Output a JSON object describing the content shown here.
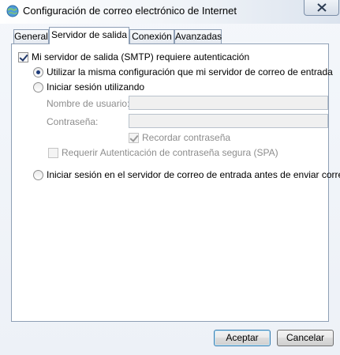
{
  "window": {
    "title": "Configuración de correo electrónico de Internet"
  },
  "tabs": [
    {
      "label": "General",
      "active": false
    },
    {
      "label": "Servidor de salida",
      "active": true
    },
    {
      "label": "Conexión",
      "active": false
    },
    {
      "label": "Avanzadas",
      "active": false
    }
  ],
  "outgoing": {
    "requires_auth": {
      "label": "Mi servidor de salida (SMTP) requiere autenticación",
      "checked": true
    },
    "option_same": {
      "label": "Utilizar la misma configuración que mi servidor de correo de entrada",
      "selected": true
    },
    "option_login": {
      "label": "Iniciar sesión utilizando",
      "selected": false
    },
    "username": {
      "label": "Nombre de usuario:",
      "value": ""
    },
    "password": {
      "label": "Contraseña:",
      "value": ""
    },
    "remember_password": {
      "label": "Recordar contraseña",
      "checked": true
    },
    "spa": {
      "label": "Requerir Autenticación de contraseña segura (SPA)",
      "checked": false
    },
    "option_before": {
      "label": "Iniciar sesión en el servidor de correo de entrada antes de enviar correo",
      "selected": false
    }
  },
  "buttons": {
    "accept": "Aceptar",
    "cancel": "Cancelar"
  },
  "icons": {
    "app": "mail-globe-icon",
    "close": "close-icon"
  },
  "colors": {
    "radio_dot": "#1d3b7a",
    "check": "#21386b",
    "disabled_text": "#8d8d8d"
  }
}
